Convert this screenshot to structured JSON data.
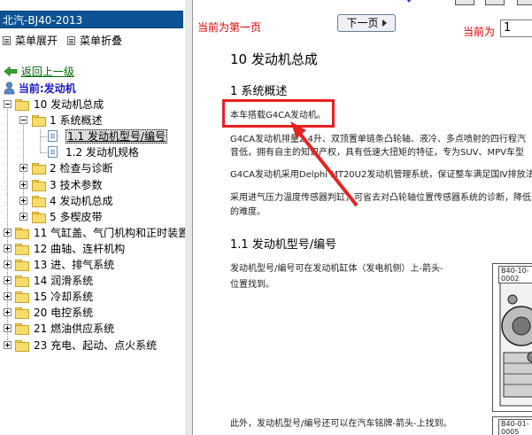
{
  "left_panel": {
    "title": "北汽-BJ40-2013",
    "expand_menu": "菜单展开",
    "collapse_menu": "菜单折叠",
    "back_link": "返回上一级",
    "current_label": "当前:发动机",
    "tree": [
      {
        "label": "10 发动机总成",
        "level": 1,
        "expanded": true,
        "type": "folder"
      },
      {
        "label": "1 系统概述",
        "level": 2,
        "expanded": true,
        "type": "folder"
      },
      {
        "label": "1.1 发动机型号/编号",
        "level": 3,
        "type": "doc",
        "selected": true
      },
      {
        "label": "1.2 发动机规格",
        "level": 3,
        "type": "doc"
      },
      {
        "label": "2 检查与诊断",
        "level": 2,
        "expanded": false,
        "type": "folder"
      },
      {
        "label": "3 技术参数",
        "level": 2,
        "expanded": false,
        "type": "folder"
      },
      {
        "label": "4 发动机总成",
        "level": 2,
        "expanded": false,
        "type": "folder"
      },
      {
        "label": "5 多楔皮带",
        "level": 2,
        "expanded": false,
        "type": "folder"
      },
      {
        "label": "11 气缸盖、气门机构和正时装置",
        "level": 1,
        "expanded": false,
        "type": "folder"
      },
      {
        "label": "12 曲轴、连杆机构",
        "level": 1,
        "expanded": false,
        "type": "folder"
      },
      {
        "label": "13 进、排气系统",
        "level": 1,
        "expanded": false,
        "type": "folder"
      },
      {
        "label": "14 润滑系统",
        "level": 1,
        "expanded": false,
        "type": "folder"
      },
      {
        "label": "15 冷却系统",
        "level": 1,
        "expanded": false,
        "type": "folder"
      },
      {
        "label": "20 电控系统",
        "level": 1,
        "expanded": false,
        "type": "folder"
      },
      {
        "label": "21 燃油供应系统",
        "level": 1,
        "expanded": false,
        "type": "folder"
      },
      {
        "label": "23 充电、起动、点火系统",
        "level": 1,
        "expanded": false,
        "type": "folder"
      }
    ]
  },
  "toolbar": {
    "page_notice": "当前为第一页",
    "next_page": "下一页",
    "current_page_label": "当前为",
    "current_page_value": "1"
  },
  "content": {
    "heading": "10 发动机总成",
    "section1": "1 系统概述",
    "intro": "本车搭载G4CA发动机。",
    "para1": "G4CA发动机排量2.4升、双顶置单链条凸轮轴、液冷、多点喷射的四行程汽",
    "para1b": "音低，拥有自主的知识产权，具有低速大扭矩的特征，专为SUV、MPV车型",
    "para2": "G4CA发动机采用Delphi MT20U2发动机管理系统，保证整车满足国Ⅳ排放法",
    "para3": "采用进气压力温度传感器判缸，可省去对凸轮轴位置传感器系统的诊断，降低",
    "para3b": "的难度。",
    "section2": "1.1 发动机型号/编号",
    "para4": "发动机型号/编号可在发动机缸体（发电机侧）上-箭头-",
    "para4b": "位置找到。",
    "para5": "此外，发动机型号/编号还可以在汽车铭牌-箭头-上找到。",
    "figure1_label": "B40-10-0002",
    "figure2_label": "B40-01-0005"
  },
  "colors": {
    "title_bar": "#0b5394",
    "page_notice": "#e00000",
    "highlight": "#e82020",
    "back_link": "#006a00",
    "current_label": "#1919c8"
  }
}
